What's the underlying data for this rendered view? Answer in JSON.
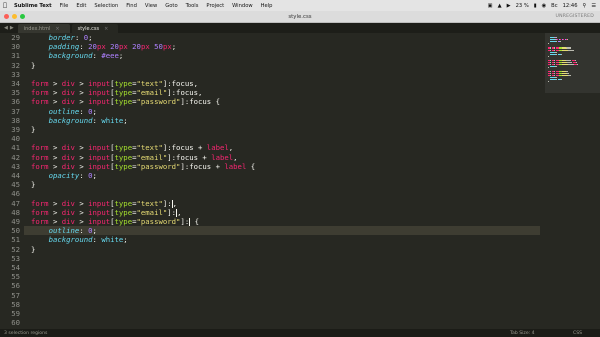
{
  "menubar": {
    "apple": "",
    "app": "Sublime Text",
    "items": [
      "File",
      "Edit",
      "Selection",
      "Find",
      "View",
      "Goto",
      "Tools",
      "Project",
      "Window",
      "Help"
    ],
    "battery": "23 %",
    "day": "Вс",
    "clock": "12:46"
  },
  "window": {
    "title": "style.css",
    "unregistered": "UNREGISTERED"
  },
  "tabs": [
    {
      "label": "index.html",
      "active": false
    },
    {
      "label": "style.css",
      "active": true
    }
  ],
  "editor": {
    "line_numbers": [
      "29",
      "30",
      "31",
      "32",
      "33",
      "34",
      "35",
      "36",
      "37",
      "38",
      "39",
      "40",
      "41",
      "42",
      "43",
      "44",
      "45",
      "46",
      "47",
      "48",
      "49",
      "50",
      "51",
      "52",
      "53",
      "54",
      "55",
      "56",
      "57",
      "58",
      "59",
      "60"
    ],
    "current_line": "49"
  },
  "status": {
    "selection": "3 selection regions",
    "tab_size": "Tab Size: 4",
    "syntax": "CSS"
  },
  "colors": {
    "background": "#272822",
    "selector_tag": "#f92672",
    "attribute": "#a6e22e",
    "string": "#e6db74",
    "property": "#66d9ef",
    "number": "#ae81ff"
  }
}
